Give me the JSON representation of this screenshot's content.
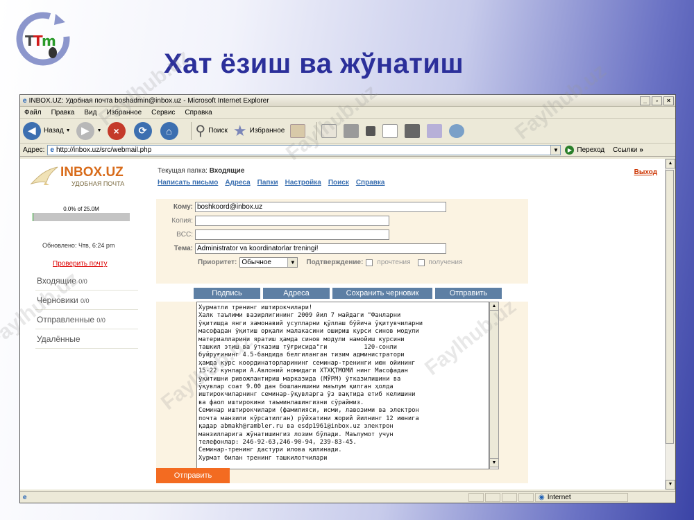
{
  "slide": {
    "title": "Хат ёзиш ва жўнатиш",
    "logo_text": "TTm"
  },
  "watermark": "Faylhub.uz",
  "window": {
    "title": "INBOX.UZ: Удобная почта boshadmin@inbox.uz - Microsoft Internet Explorer",
    "menu": [
      "Файл",
      "Правка",
      "Вид",
      "Избранное",
      "Сервис",
      "Справка"
    ],
    "toolbar": {
      "back": "Назад",
      "search": "Поиск",
      "favorites": "Избранное"
    },
    "address_label": "Адрес:",
    "address": "http://inbox.uz/src/webmail.php",
    "go": "Переход",
    "links": "Ссылки",
    "status_zone": "Internet"
  },
  "webmail": {
    "brand": "INBOX.UZ",
    "brand_sub": "УДОБНАЯ ПОЧТА",
    "quota": {
      "text": "0.0% of 25.0M",
      "fraction": 0.01
    },
    "updated": "Обновлено: Чтв, 6:24 pm",
    "check_mail": "Проверить почту",
    "folders": [
      {
        "name": "Входящие",
        "count": "0/0"
      },
      {
        "name": "Черновики",
        "count": "0/0"
      },
      {
        "name": "Отправленные",
        "count": "0/0"
      },
      {
        "name": "Удалённые",
        "count": ""
      }
    ],
    "current_folder_label": "Текущая папка:",
    "current_folder": "Входящие",
    "nav": [
      "Написать письмо",
      "Адреса",
      "Папки",
      "Настройка",
      "Поиск",
      "Справка"
    ],
    "logout": "Выход",
    "to_label": "Кому:",
    "to_value": "boshkoord@inbox.uz",
    "cc_label": "Копия:",
    "cc_value": "",
    "bcc_label": "BCC:",
    "bcc_value": "",
    "subject_label": "Тема:",
    "subject_value": "Administrator va koordinatorlar treningi!",
    "priority_label": "Приоритет:",
    "priority_value": "Обычное",
    "confirm_label": "Подтверждение:",
    "read_label": "прочтения",
    "receive_label": "получения",
    "buttons": {
      "signature": "Подпись",
      "addresses": "Адреса",
      "save_draft": "Сохранить черновик",
      "send": "Отправить"
    },
    "body": "Хурматли тренинг иштирокчилари!\nХалк таълими вазирлигининг 2009 йил 7 майдаги \"Фанларни\nўқитишда янги замонавий усулларни қўллаш бўйича ўқитувчиларни\nмасофадан ўқитиш орқали малакасини ошириш курси синов модули\nматериалларини яратиш ҳамда синов модули намойиш курсини\nташкил этиш ва ўтказиш тўғрисида\"ги          120-сонли\nбуйруғининг 4.5-бандида белгиланган тизим администратори\nҳамда курс координаторларининг семинар-тренинги июн ойининг\n15-22 кунлари А.Авлоний номидаги ХТХҚТМОМИ нинг Масофадан\nўқитишни ривожлантириш марказида (МЎРМ) ўтказилишини ва\nўқувлар соат 9.00 дан бошланишини маълум қилган ҳолда\nиштирокчиларнинг семинар-ўқувларга ўз вақтида етиб келишини\nва фаол иштирокини таъминлашингизни сўраймиз.\nСеминар иштирокчилари (фамилияси, исми, лавозими ва электрон\nпочта манзили кўрсатилган) рўйхатини жорий йилнинг 12 июнига\nқадар abmakh@rambler.ru ва esdp1961@inbox.uz электрон\nманзилларига жўнатишингиз лозим бўлади. Маълумот учун\nтелефонлар: 246-92-63,246-90-94, 239-83-45.\nСеминар-тренинг дастури илова қилинади.\nХурмат билан тренинг ташкилотчилари",
    "send_bottom": "Отправить"
  }
}
